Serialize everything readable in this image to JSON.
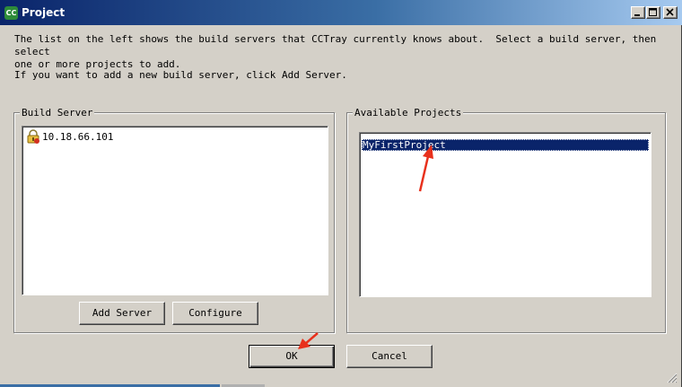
{
  "window": {
    "title": "Project",
    "icon_text": "CC",
    "controls": [
      "minimize-icon",
      "maximize-icon",
      "close-icon"
    ]
  },
  "intro": {
    "line1": "The list on the left shows the build servers that CCTray currently knows about.  Select a build server, then select\none or more projects to add.",
    "line2": "If you want to add a new build server, click Add Server."
  },
  "build_server": {
    "label": "Build Server",
    "items": [
      {
        "label": "10.18.66.101",
        "icon": "server-lock-icon"
      }
    ],
    "add_server_label": "Add Server",
    "configure_label": "Configure"
  },
  "available_projects": {
    "label": "Available Projects",
    "items": [
      {
        "label": "MyFirstProject",
        "selected": true
      }
    ]
  },
  "footer": {
    "ok_label": "OK",
    "cancel_label": "Cancel"
  },
  "colors": {
    "titlebar_start": "#0a246a",
    "titlebar_end": "#a6caf0",
    "selection": "#0a246a",
    "annotation_arrow": "#e8301c",
    "dialog_bg": "#d4d0c8"
  }
}
